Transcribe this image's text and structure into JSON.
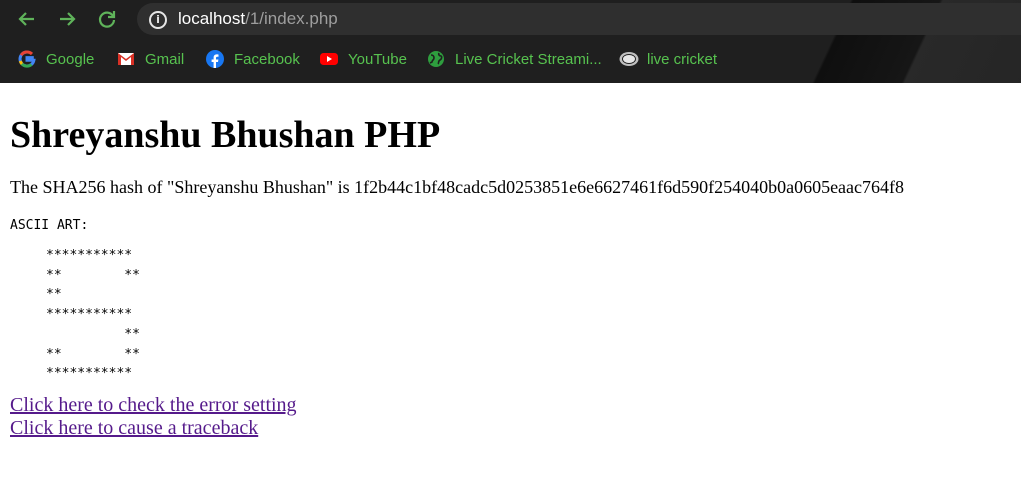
{
  "browser": {
    "url_host": "localhost",
    "url_path": "/1/index.php",
    "bookmarks": [
      {
        "label": "Google",
        "icon": "google-icon"
      },
      {
        "label": "Gmail",
        "icon": "gmail-icon"
      },
      {
        "label": "Facebook",
        "icon": "facebook-icon"
      },
      {
        "label": "YouTube",
        "icon": "youtube-icon"
      },
      {
        "label": "Live Cricket Streami...",
        "icon": "globe-icon"
      },
      {
        "label": "live cricket",
        "icon": "fox-icon"
      }
    ],
    "accent_color": "#57c24f"
  },
  "page": {
    "title": "Shreyanshu Bhushan PHP",
    "hash_text": "The SHA256 hash of \"Shreyanshu Bhushan\" is 1f2b44c1bf48cadc5d0253851e6e6627461f6d590f254040b0a0605eaac764f8",
    "ascii_label": "ASCII ART:",
    "ascii_art": "***********\n**        **\n**\n***********\n          **\n**        **\n***********",
    "links": {
      "error_setting": "Click here to check the error setting",
      "traceback": "Click here to cause a traceback"
    },
    "link_color": "#551a8b"
  }
}
